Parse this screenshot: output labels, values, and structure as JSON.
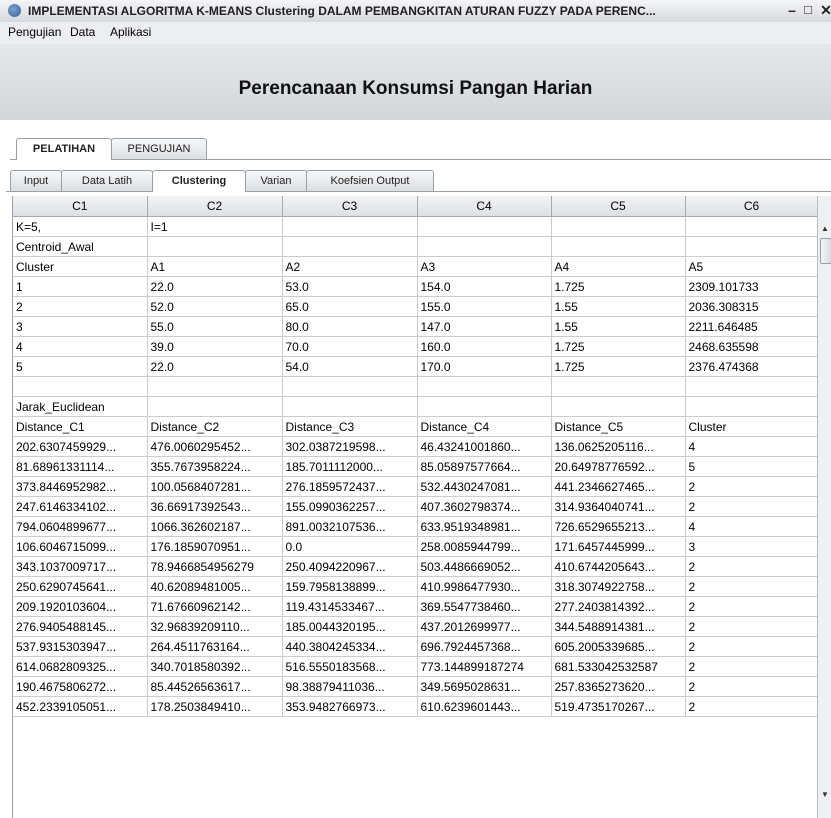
{
  "window": {
    "title": "IMPLEMENTASI ALGORITMA K-MEANS Clustering DALAM PEMBANGKITAN ATURAN FUZZY PADA PERENC..."
  },
  "icons": {
    "window": "app-icon",
    "minimize": "minimize-icon",
    "maximize": "maximize-icon",
    "close": "close-icon",
    "scroll_up": "scroll-up-icon",
    "scroll_down": "scroll-down-icon"
  },
  "menu": {
    "items": [
      "Pengujian",
      "Data",
      "Aplikasi"
    ]
  },
  "header": {
    "title": "Perencanaan Konsumsi Pangan Harian"
  },
  "outer_tabs": [
    {
      "label": "PELATIHAN",
      "active": true
    },
    {
      "label": "PENGUJIAN",
      "active": false
    }
  ],
  "inner_tabs": [
    {
      "label": "Input",
      "active": false
    },
    {
      "label": "Data Latih",
      "active": false
    },
    {
      "label": "Clustering",
      "active": true
    },
    {
      "label": "Varian",
      "active": false
    },
    {
      "label": "Koefsien Output",
      "active": false
    }
  ],
  "table": {
    "headers": [
      "C1",
      "C2",
      "C3",
      "C4",
      "C5",
      "C6"
    ],
    "rows": [
      [
        "K=5,",
        "I=1",
        "",
        "",
        "",
        ""
      ],
      [
        "Centroid_Awal",
        "",
        "",
        "",
        "",
        ""
      ],
      [
        "Cluster",
        "A1",
        "A2",
        "A3",
        "A4",
        "A5"
      ],
      [
        "1",
        "22.0",
        "53.0",
        "154.0",
        "1.725",
        "2309.101733"
      ],
      [
        "2",
        "52.0",
        "65.0",
        "155.0",
        "1.55",
        "2036.308315"
      ],
      [
        "3",
        "55.0",
        "80.0",
        "147.0",
        "1.55",
        "2211.646485"
      ],
      [
        "4",
        "39.0",
        "70.0",
        "160.0",
        "1.725",
        "2468.635598"
      ],
      [
        "5",
        "22.0",
        "54.0",
        "170.0",
        "1.725",
        "2376.474368"
      ],
      [
        "",
        "",
        "",
        "",
        "",
        ""
      ],
      [
        "Jarak_Euclidean",
        "",
        "",
        "",
        "",
        ""
      ],
      [
        "Distance_C1",
        "Distance_C2",
        "Distance_C3",
        "Distance_C4",
        "Distance_C5",
        "Cluster"
      ],
      [
        "202.6307459929...",
        "476.0060295452...",
        "302.0387219598...",
        "46.43241001860...",
        "136.0625205116...",
        "4"
      ],
      [
        "81.68961331114...",
        "355.7673958224...",
        "185.7011112000...",
        "85.05897577664...",
        "20.64978776592...",
        "5"
      ],
      [
        "373.8446952982...",
        "100.0568407281...",
        "276.1859572437...",
        "532.4430247081...",
        "441.2346627465...",
        "2"
      ],
      [
        "247.6146334102...",
        "36.66917392543...",
        "155.0990362257...",
        "407.3602798374...",
        "314.9364040741...",
        "2"
      ],
      [
        "794.0604899677...",
        "1066.362602187...",
        "891.0032107536...",
        "633.9519348981...",
        "726.6529655213...",
        "4"
      ],
      [
        "106.6046715099...",
        "176.1859070951...",
        "0.0",
        "258.0085944799...",
        "171.6457445999...",
        "3"
      ],
      [
        "343.1037009717...",
        "78.9466854956279",
        "250.4094220967...",
        "503.4486669052...",
        "410.6744205643...",
        "2"
      ],
      [
        "250.6290745641...",
        "40.62089481005...",
        "159.7958138899...",
        "410.9986477930...",
        "318.3074922758...",
        "2"
      ],
      [
        "209.1920103604...",
        "71.67660962142...",
        "119.4314533467...",
        "369.5547738460...",
        "277.2403814392...",
        "2"
      ],
      [
        "276.9405488145...",
        "32.96839209110...",
        "185.0044320195...",
        "437.2012699977...",
        "344.5488914381...",
        "2"
      ],
      [
        "537.9315303947...",
        "264.4511763164...",
        "440.3804245334...",
        "696.7924457368...",
        "605.2005339685...",
        "2"
      ],
      [
        "614.0682809325...",
        "340.7018580392...",
        "516.5550183568...",
        "773.144899187274",
        "681.533042532587",
        "2"
      ],
      [
        "190.4675806272...",
        "85.44526563617...",
        "98.38879411036...",
        "349.5695028631...",
        "257.8365273620...",
        "2"
      ],
      [
        "452.2339105051...",
        "178.2503849410...",
        "353.9482766973...",
        "610.6239601443...",
        "519.4735170267...",
        "2"
      ]
    ]
  }
}
